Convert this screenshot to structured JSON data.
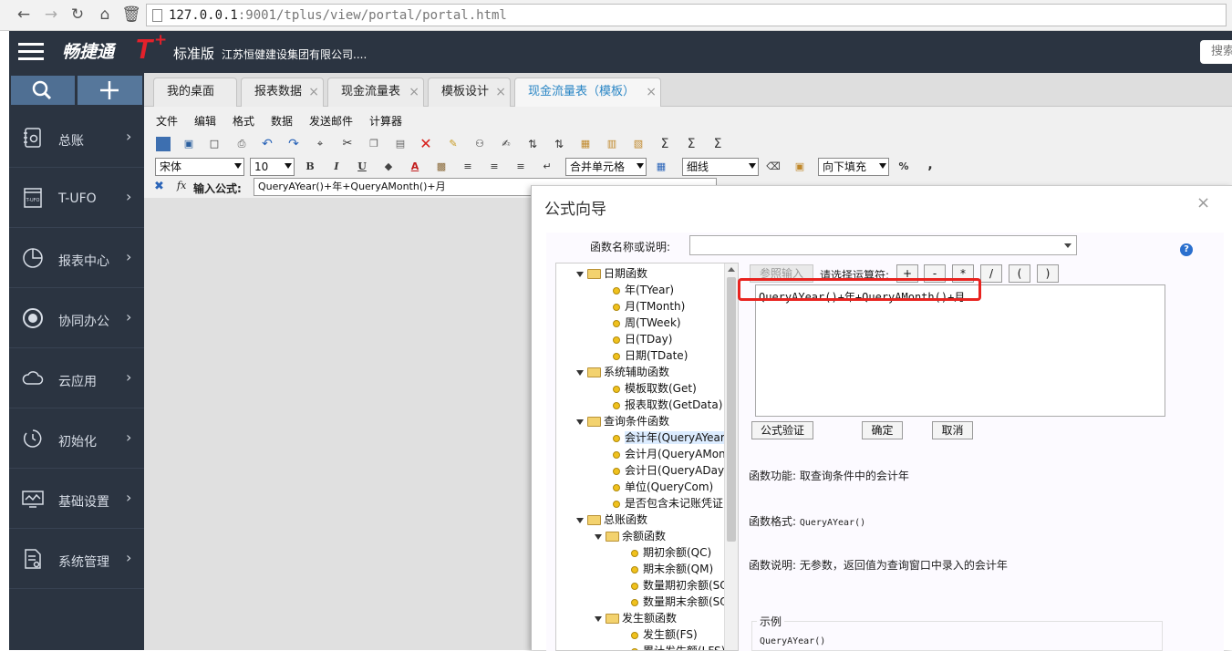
{
  "browser": {
    "url_host": "127.0.0.1",
    "url_rest": ":9001/tplus/view/portal/portal.html"
  },
  "header": {
    "brand": "畅捷通",
    "brand_t": "T",
    "brand_plus": "+",
    "edition": "标准版",
    "company": "江苏恒健建设集团有限公司....",
    "search_label": "搜索"
  },
  "sidebar": {
    "items": [
      {
        "label": "总账",
        "icon": "ledger-icon"
      },
      {
        "label": "T-UFO",
        "icon": "tufo-icon"
      },
      {
        "label": "报表中心",
        "icon": "pie-chart-icon"
      },
      {
        "label": "协同办公",
        "icon": "collaboration-icon"
      },
      {
        "label": "云应用",
        "icon": "cloud-icon"
      },
      {
        "label": "初始化",
        "icon": "reset-icon"
      },
      {
        "label": "基础设置",
        "icon": "settings-monitor-icon"
      },
      {
        "label": "系统管理",
        "icon": "system-doc-icon"
      }
    ]
  },
  "tabs": [
    {
      "label": "我的桌面"
    },
    {
      "label": "报表数据"
    },
    {
      "label": "现金流量表"
    },
    {
      "label": "模板设计"
    },
    {
      "label": "现金流量表（模板）"
    }
  ],
  "menu": [
    "文件",
    "编辑",
    "格式",
    "数据",
    "发送邮件",
    "计算器"
  ],
  "toolbar": {
    "font_family": "宋体",
    "font_size": "10",
    "bold": "B",
    "italic": "I",
    "underline": "U",
    "font_color": "A",
    "merge": "合并单元格",
    "line": "细线",
    "fill": "向下填充",
    "percent": "%",
    "comma": ","
  },
  "formula_bar": {
    "fx": "fx",
    "label": "输入公式:",
    "value": "QueryAYear()+年+QueryAMonth()+月"
  },
  "dialog": {
    "title": "公式向导",
    "close": "×",
    "fn_name_label": "函数名称或说明:",
    "help": "?",
    "ref_button": "参照输入",
    "operator_label": "请选择运算符:",
    "operators": [
      "+",
      "-",
      "*",
      "/",
      "(",
      ")"
    ],
    "formula": "QueryAYear()+年+QueryAMonth()+月",
    "validate_button": "公式验证",
    "ok_button": "确定",
    "cancel_button": "取消",
    "func_desc_label": "函数功能:",
    "func_desc": "取查询条件中的会计年",
    "func_format_label": "函数格式:",
    "func_format": "QueryAYear()",
    "func_note_label": "函数说明:",
    "func_note": "无参数，返回值为查询窗口中录入的会计年",
    "example_title": "示例",
    "example_text": "QueryAYear()",
    "tree": [
      {
        "label": "日期函数",
        "type": "folder",
        "level": 0
      },
      {
        "label": "年(TYear)",
        "type": "leaf",
        "level": 1
      },
      {
        "label": "月(TMonth)",
        "type": "leaf",
        "level": 1
      },
      {
        "label": "周(TWeek)",
        "type": "leaf",
        "level": 1
      },
      {
        "label": "日(TDay)",
        "type": "leaf",
        "level": 1
      },
      {
        "label": "日期(TDate)",
        "type": "leaf",
        "level": 1
      },
      {
        "label": "系统辅助函数",
        "type": "folder",
        "level": 0
      },
      {
        "label": "模板取数(Get)",
        "type": "leaf",
        "level": 1
      },
      {
        "label": "报表取数(GetData)",
        "type": "leaf",
        "level": 1
      },
      {
        "label": "查询条件函数",
        "type": "folder",
        "level": 0
      },
      {
        "label": "会计年(QueryAYear)",
        "type": "leaf",
        "level": 1,
        "selected": true
      },
      {
        "label": "会计月(QueryAMonth)",
        "type": "leaf",
        "level": 1
      },
      {
        "label": "会计日(QueryADay)",
        "type": "leaf",
        "level": 1
      },
      {
        "label": "单位(QueryCom)",
        "type": "leaf",
        "level": 1
      },
      {
        "label": "是否包含未记账凭证(",
        "type": "leaf",
        "level": 1
      },
      {
        "label": "总账函数",
        "type": "folder",
        "level": 0
      },
      {
        "label": "余额函数",
        "type": "folder",
        "level": 1
      },
      {
        "label": "期初余额(QC)",
        "type": "leaf",
        "level": 2
      },
      {
        "label": "期末余额(QM)",
        "type": "leaf",
        "level": 2
      },
      {
        "label": "数量期初余额(SQ",
        "type": "leaf",
        "level": 2
      },
      {
        "label": "数量期末余额(SQ",
        "type": "leaf",
        "level": 2
      },
      {
        "label": "发生额函数",
        "type": "folder",
        "level": 1
      },
      {
        "label": "发生额(FS)",
        "type": "leaf",
        "level": 2
      },
      {
        "label": "累计发生额(LFS)",
        "type": "leaf",
        "level": 2
      }
    ]
  }
}
